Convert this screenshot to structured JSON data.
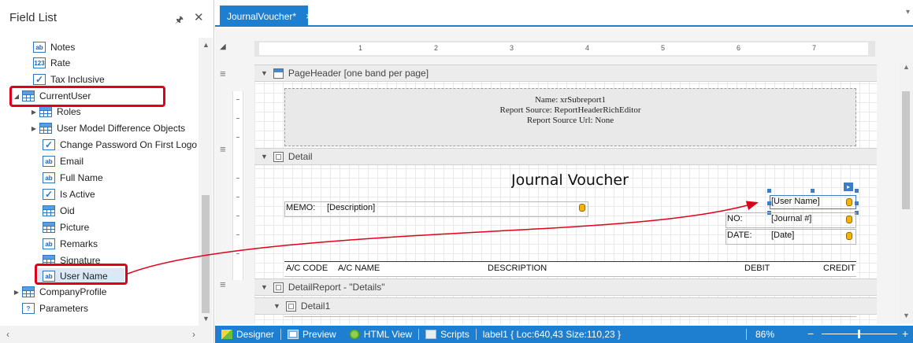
{
  "field_list": {
    "title": "Field List",
    "pin_icon": "pin-icon",
    "close_icon": "close-icon",
    "items": [
      {
        "label": "Notes",
        "icon": "ab",
        "expander": ""
      },
      {
        "label": "Rate",
        "icon": "123",
        "expander": ""
      },
      {
        "label": "Tax Inclusive",
        "icon": "check",
        "expander": ""
      },
      {
        "label": "CurrentUser",
        "icon": "table",
        "expander": "◢"
      },
      {
        "label": "Roles",
        "icon": "table",
        "expander": "▶"
      },
      {
        "label": "User Model Difference Objects",
        "icon": "table",
        "expander": "▶"
      },
      {
        "label": "Change Password On First Logo",
        "icon": "check",
        "expander": ""
      },
      {
        "label": "Email",
        "icon": "ab",
        "expander": ""
      },
      {
        "label": "Full Name",
        "icon": "ab",
        "expander": ""
      },
      {
        "label": "Is Active",
        "icon": "check",
        "expander": ""
      },
      {
        "label": "Oid",
        "icon": "table",
        "expander": ""
      },
      {
        "label": "Picture",
        "icon": "table",
        "expander": ""
      },
      {
        "label": "Remarks",
        "icon": "ab",
        "expander": ""
      },
      {
        "label": "Signature",
        "icon": "table",
        "expander": ""
      },
      {
        "label": "User Name",
        "icon": "ab",
        "expander": ""
      },
      {
        "label": "CompanyProfile",
        "icon": "table",
        "expander": "▶"
      },
      {
        "label": "Parameters",
        "icon": "?",
        "expander": ""
      }
    ]
  },
  "document": {
    "tab_label": "JournalVoucher*",
    "tab_close": "×"
  },
  "ruler": {
    "marks": [
      "1",
      "2",
      "3",
      "4",
      "5",
      "6",
      "7"
    ]
  },
  "bands": {
    "page_header": "PageHeader [one band per page]",
    "detail": "Detail",
    "detail_report": "DetailReport - \"Details\"",
    "detail1": "Detail1"
  },
  "subreport": {
    "line1": "Name: xrSubreport1",
    "line2": "Report Source: ReportHeaderRichEditor",
    "line3": "Report Source Url: None"
  },
  "report": {
    "title": "Journal Voucher",
    "memo_label": "MEMO:",
    "memo_value": "[Description]",
    "user_name": "[User Name]",
    "no_label": "NO:",
    "no_value": "[Journal #]",
    "date_label": "DATE:",
    "date_value": "[Date]",
    "columns": [
      "A/C CODE",
      "A/C NAME",
      "DESCRIPTION",
      "DEBIT",
      "CREDIT"
    ]
  },
  "status_bar": {
    "designer": "Designer",
    "preview": "Preview",
    "html_view": "HTML View",
    "scripts": "Scripts",
    "info": "label1 { Loc:640,43 Size:110,23 }",
    "zoom": "86%",
    "zoom_minus": "−",
    "zoom_plus": "+"
  },
  "colors": {
    "accent": "#1e7fd1",
    "highlight": "#e0001b",
    "band_caption": "#ececec"
  }
}
